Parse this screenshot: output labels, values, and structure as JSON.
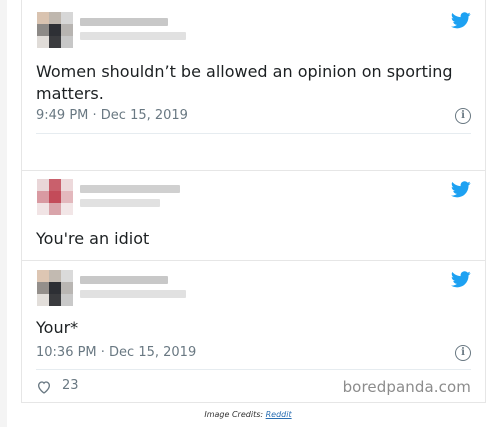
{
  "tweets": [
    {
      "text": "Women shouldn’t be allowed an opinion on sporting matters.",
      "timestamp": "9:49 PM · Dec 15, 2019"
    },
    {
      "text": "You're an idiot"
    },
    {
      "text": "Your*",
      "timestamp": "10:36 PM · Dec 15, 2019",
      "likes": "23"
    }
  ],
  "watermark": "boredpanda.com",
  "credits": {
    "prefix": "Image Credits: ",
    "link": "Reddit"
  },
  "colors": {
    "twitter_blue": "#1da1f2",
    "meta_gray": "#697882",
    "text": "#1c2022"
  },
  "icons": [
    "twitter-bird-icon",
    "info-icon",
    "heart-icon"
  ]
}
